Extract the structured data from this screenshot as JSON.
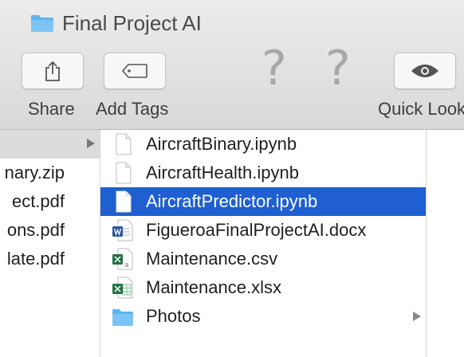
{
  "window": {
    "title": "Final Project AI"
  },
  "toolbar": {
    "share_label": "Share",
    "add_tags_label": "Add Tags",
    "quick_look_label": "Quick Look",
    "unknown_mark": "?"
  },
  "column1": {
    "items": [
      "nary.zip",
      "ect.pdf",
      "ons.pdf",
      "late.pdf"
    ]
  },
  "column2": {
    "items": [
      {
        "name": "AircraftBinary.ipynb",
        "icon": "document-icon"
      },
      {
        "name": "AircraftHealth.ipynb",
        "icon": "document-icon"
      },
      {
        "name": "AircraftPredictor.ipynb",
        "icon": "document-icon",
        "selected": true
      },
      {
        "name": "FigueroaFinalProjectAI.docx",
        "icon": "word-doc-icon"
      },
      {
        "name": "Maintenance.csv",
        "icon": "csv-icon"
      },
      {
        "name": "Maintenance.xlsx",
        "icon": "excel-icon"
      },
      {
        "name": "Photos",
        "icon": "folder-icon"
      }
    ]
  },
  "colors": {
    "selection": "#1f5fd1",
    "folder": "#5fb3ef",
    "word": "#2b579a",
    "excel": "#217346"
  }
}
